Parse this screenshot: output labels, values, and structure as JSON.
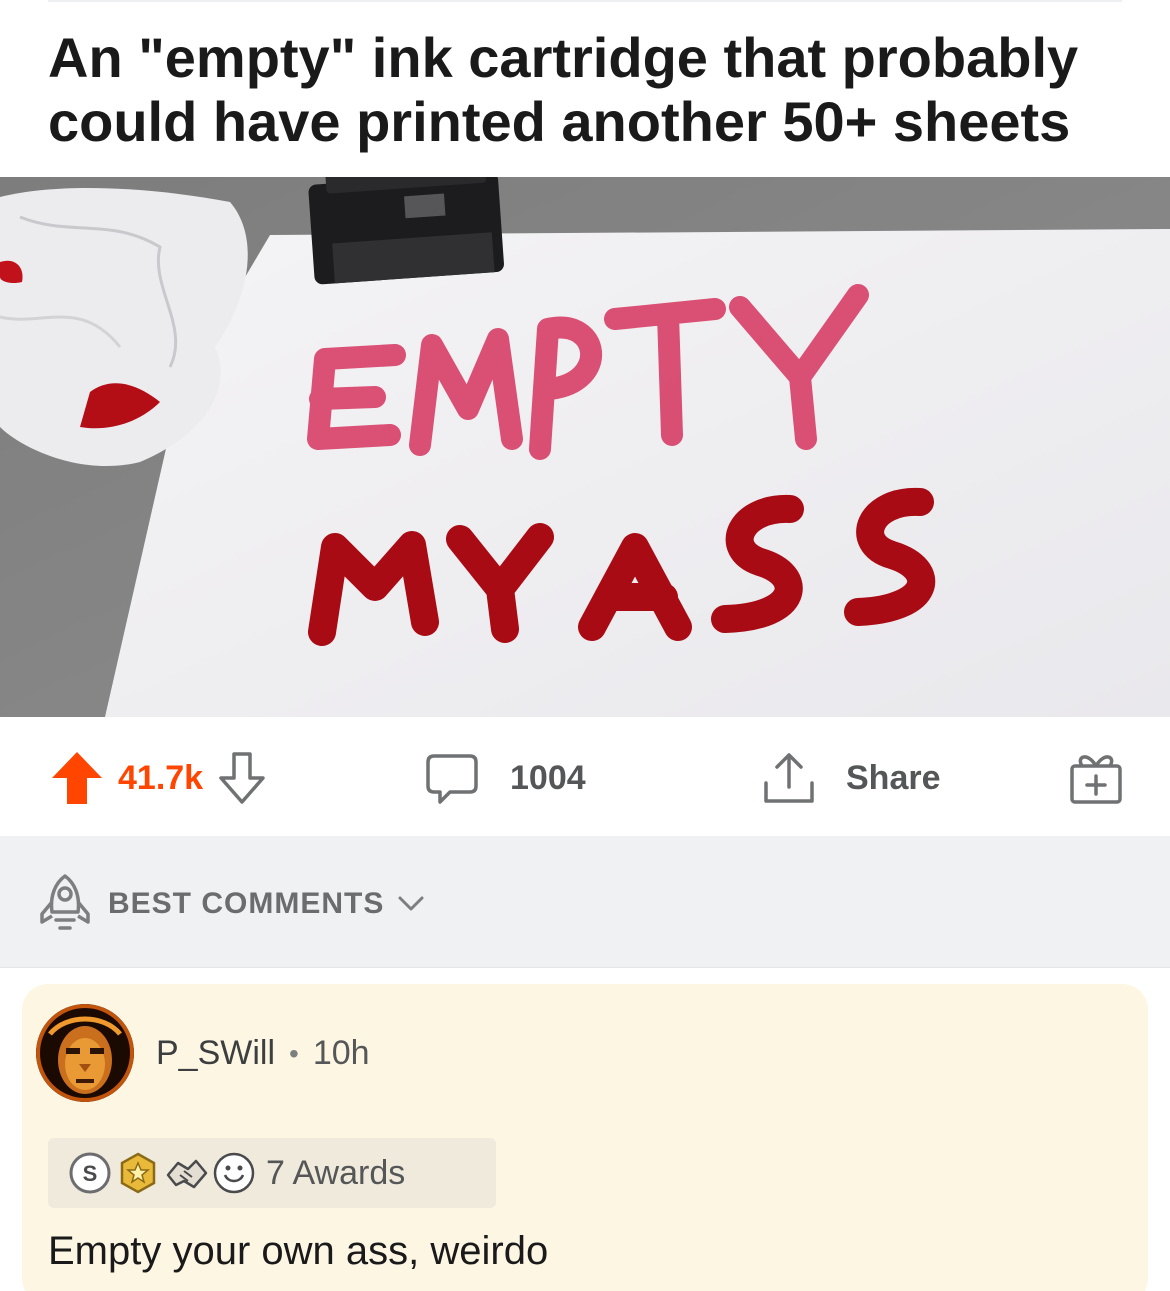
{
  "post": {
    "title": "An \"empty\" ink cartridge that probably could have printed another 50+ sheets",
    "image": {
      "sign_line_1": "EMPTY",
      "sign_line_2": "MY ASS"
    }
  },
  "actions": {
    "score": "41.7k",
    "comment_count": "1004",
    "share_label": "Share",
    "upvote_state": "upvoted",
    "accent_color": "#ff4500"
  },
  "sort": {
    "label": "BEST COMMENTS",
    "icon": "rocket-icon"
  },
  "comment": {
    "username": "P_SWill",
    "separator": "•",
    "age": "10h",
    "awards_label": "7 Awards",
    "award_icons": [
      "silver-award-icon",
      "gold-badge-award-icon",
      "handshake-award-icon",
      "wholesome-award-icon"
    ],
    "body": "Empty your own ass, weirdo",
    "highlight_color": "#fcf6e3"
  }
}
